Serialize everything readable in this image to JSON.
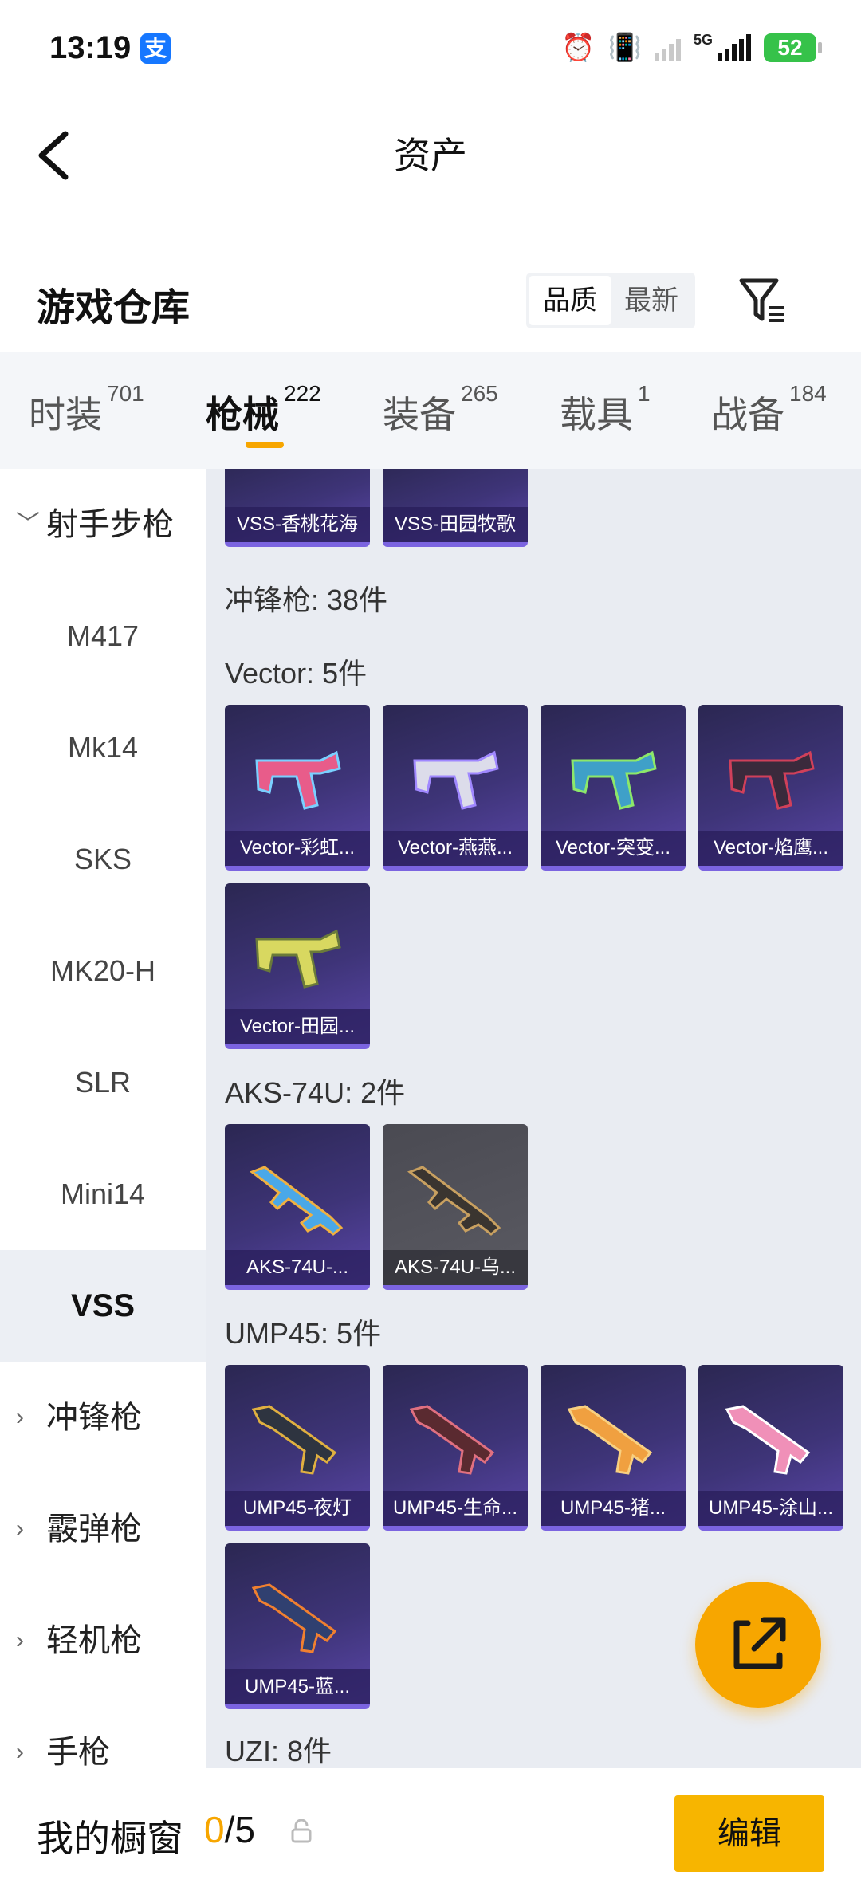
{
  "status_bar": {
    "time": "13:19",
    "alipay_badge": "支",
    "net_label": "5G",
    "battery": "52"
  },
  "nav": {
    "title": "资产"
  },
  "warehouse": {
    "title": "游戏仓库",
    "sort_options": [
      "品质",
      "最新"
    ],
    "active_sort": "品质"
  },
  "tabs": [
    {
      "label": "时装",
      "count": "701"
    },
    {
      "label": "枪械",
      "count": "222",
      "active": true
    },
    {
      "label": "装备",
      "count": "265"
    },
    {
      "label": "载具",
      "count": "1"
    },
    {
      "label": "战备",
      "count": "184"
    }
  ],
  "sidebar": {
    "group_expanded": "射手步枪",
    "items": [
      "M417",
      "Mk14",
      "SKS",
      "MK20-H",
      "SLR",
      "Mini14",
      "VSS"
    ],
    "active_item": "VSS",
    "collapsed_groups": [
      "冲锋枪",
      "霰弹枪",
      "轻机枪",
      "手枪"
    ]
  },
  "content": {
    "top_cards": [
      "VSS-香桃花海",
      "VSS-田园牧歌"
    ],
    "category_header": "冲锋枪: 38件",
    "groups": [
      {
        "title": "Vector: 5件",
        "items": [
          "Vector-彩虹...",
          "Vector-燕燕...",
          "Vector-突变...",
          "Vector-焰鹰...",
          "Vector-田园..."
        ]
      },
      {
        "title": "AKS-74U: 2件",
        "items": [
          "AKS-74U-...",
          "AKS-74U-乌..."
        ]
      },
      {
        "title": "UMP45: 5件",
        "items": [
          "UMP45-夜灯",
          "UMP45-生命...",
          "UMP45-猪...",
          "UMP45-涂山...",
          "UMP45-蓝..."
        ]
      },
      {
        "title": "UZI: 8件",
        "items": []
      }
    ]
  },
  "bottom": {
    "showcase_label": "我的橱窗",
    "showcase_current": "0",
    "showcase_total": "/5",
    "edit_label": "编辑"
  },
  "colors": {
    "accent": "#f7a600",
    "card_bg": "#3e3478",
    "card_border": "#7b64e0"
  }
}
